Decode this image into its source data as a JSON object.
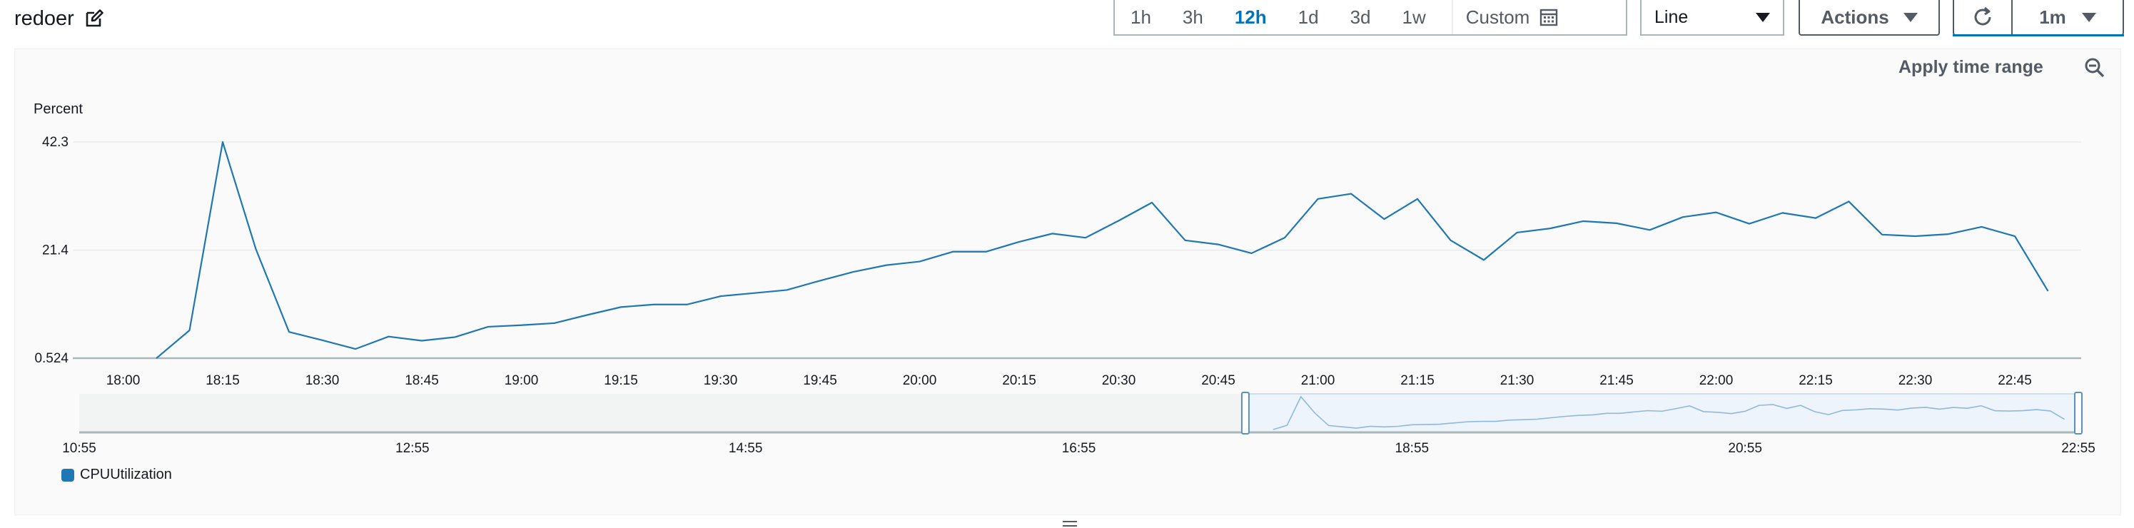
{
  "header": {
    "title": "redoer",
    "ranges": [
      "1h",
      "3h",
      "12h",
      "1d",
      "3d",
      "1w"
    ],
    "active_range": "12h",
    "custom_label": "Custom",
    "chart_type_value": "Line",
    "actions_label": "Actions",
    "refresh_interval": "1m"
  },
  "panel": {
    "apply_time_range_label": "Apply time range"
  },
  "colors": {
    "series": "#1f77b4",
    "accent": "#0073bb",
    "grid": "#e9ebed",
    "axis": "#aab7b8",
    "navigator_selection": "#eef4fb"
  },
  "icons": {
    "edit": "edit-icon",
    "calendar": "calendar-icon",
    "refresh": "refresh-icon",
    "zoom_out": "zoom-out-icon"
  },
  "chart_data": {
    "type": "line",
    "ylabel": "Percent",
    "xlabel": "",
    "yticks": [
      "42.3",
      "21.4",
      "0.524"
    ],
    "ylim": [
      0.524,
      42.3
    ],
    "xticks": [
      "18:00",
      "18:15",
      "18:30",
      "18:45",
      "19:00",
      "19:15",
      "19:30",
      "19:45",
      "20:00",
      "20:15",
      "20:30",
      "20:45",
      "21:00",
      "21:15",
      "21:30",
      "21:45",
      "22:00",
      "22:15",
      "22:30",
      "22:45"
    ],
    "xlim": [
      "17:55",
      "22:55"
    ],
    "grid": true,
    "legend_position": "bottom-left",
    "series": [
      {
        "name": "CPUUtilization",
        "x": [
          "18:05",
          "18:10",
          "18:15",
          "18:20",
          "18:25",
          "18:30",
          "18:35",
          "18:40",
          "18:45",
          "18:50",
          "18:55",
          "19:00",
          "19:05",
          "19:10",
          "19:15",
          "19:20",
          "19:25",
          "19:30",
          "19:35",
          "19:40",
          "19:45",
          "19:50",
          "19:55",
          "20:00",
          "20:05",
          "20:10",
          "20:15",
          "20:20",
          "20:25",
          "20:30",
          "20:35",
          "20:40",
          "20:45",
          "20:50",
          "20:55",
          "21:00",
          "21:05",
          "21:10",
          "21:15",
          "21:20",
          "21:25",
          "21:30",
          "21:35",
          "21:40",
          "21:45",
          "21:50",
          "21:55",
          "22:00",
          "22:05",
          "22:10",
          "22:15",
          "22:20",
          "22:25",
          "22:30",
          "22:35",
          "22:40",
          "22:45",
          "22:50"
        ],
        "values": [
          0.5,
          5.9,
          42.3,
          21.6,
          5.6,
          4.0,
          2.3,
          4.7,
          3.9,
          4.6,
          6.6,
          6.9,
          7.3,
          8.9,
          10.4,
          10.9,
          10.9,
          12.5,
          13.1,
          13.7,
          15.5,
          17.2,
          18.5,
          19.2,
          21.1,
          21.1,
          23.0,
          24.6,
          23.8,
          27.1,
          30.6,
          23.3,
          22.5,
          20.8,
          23.8,
          31.3,
          32.3,
          27.4,
          31.3,
          23.3,
          19.5,
          24.8,
          25.6,
          27.0,
          26.6,
          25.3,
          27.8,
          28.7,
          26.5,
          28.6,
          27.6,
          30.8,
          24.4,
          24.1,
          24.5,
          25.9,
          24.1,
          13.5
        ]
      }
    ],
    "navigator": {
      "xticks": [
        "10:55",
        "12:55",
        "14:55",
        "16:55",
        "18:55",
        "20:55",
        "22:55"
      ],
      "selection": [
        "17:55",
        "22:55"
      ]
    }
  }
}
